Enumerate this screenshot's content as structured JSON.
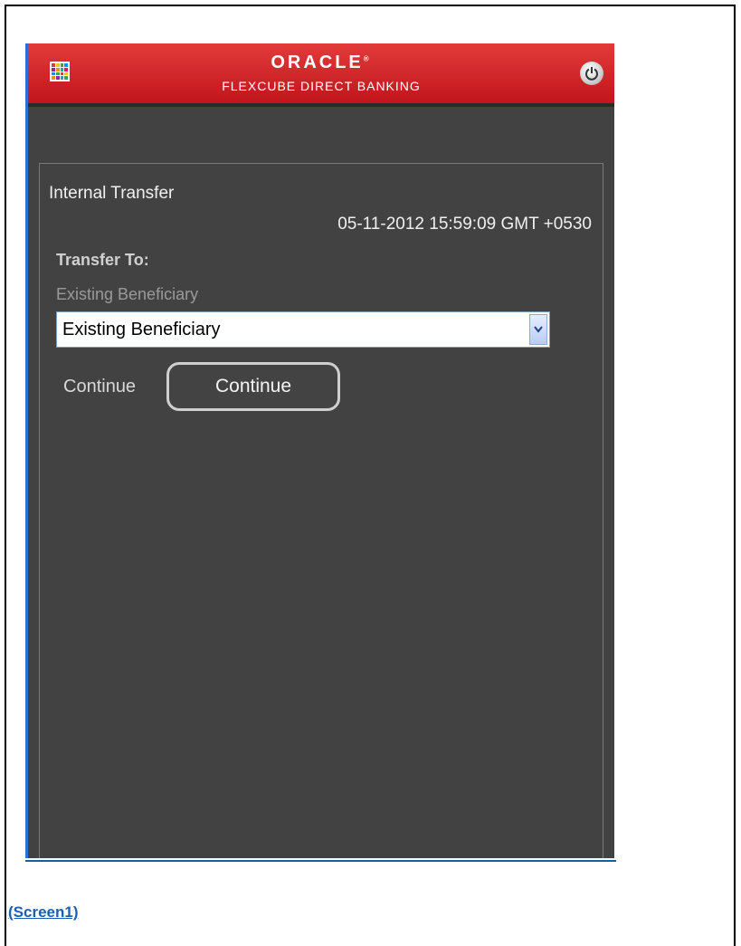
{
  "header": {
    "brand": "ORACLE",
    "brand_mark": "®",
    "product": "FLEXCUBE DIRECT BANKING",
    "menu_icon": "app-grid-icon",
    "power_icon": "power-icon"
  },
  "content": {
    "page_title": "Internal Transfer",
    "timestamp": "05-11-2012 15:59:09 GMT +0530",
    "section_label": "Transfer To:",
    "field_label": "Existing Beneficiary",
    "select_value": "Existing Beneficiary",
    "continue_label": "Continue",
    "continue_button": "Continue"
  },
  "caption": "(Screen1)",
  "colors": {
    "header_red": "#c0161c",
    "body_bg": "#424242",
    "frame_border": "#2a6fd6",
    "caption_link": "#1a5fb4"
  }
}
